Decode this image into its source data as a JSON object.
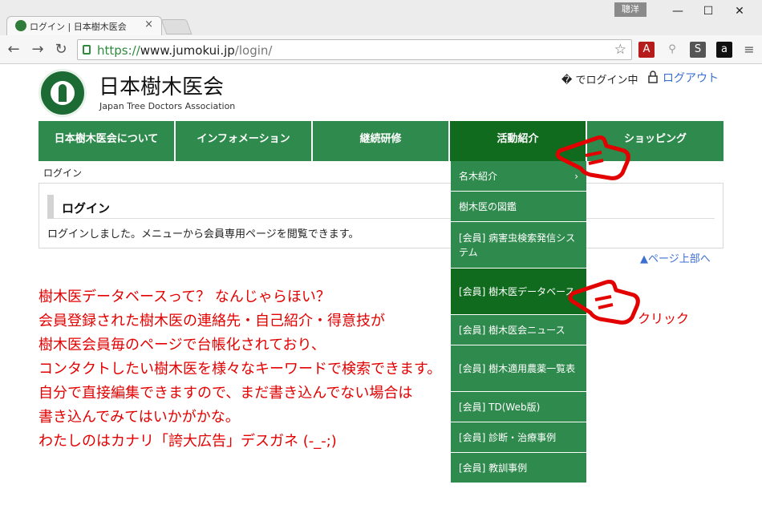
{
  "browser": {
    "tab_title": "ログイン | 日本樹木医会",
    "tab_close": "×",
    "lang_badge": "聰洋",
    "url_scheme": "https://",
    "url_host": "www.jumokui.jp",
    "url_path": "/login/"
  },
  "site": {
    "title": "日本樹木医会",
    "subtitle": "Japan Tree Doctors Association",
    "login_status": "� でログイン中",
    "logout": "ログアウト"
  },
  "nav": {
    "items": [
      {
        "label": "日本樹木医会について"
      },
      {
        "label": "インフォメーション"
      },
      {
        "label": "継続研修"
      },
      {
        "label": "活動紹介"
      },
      {
        "label": "ショッピング"
      }
    ]
  },
  "breadcrumb": "ログイン",
  "login": {
    "title": "ログイン",
    "message": "ログインしました。メニューから会員専用ページを閲覧できます。"
  },
  "page_top": "▲ページ上部へ",
  "dropdown": {
    "items": [
      {
        "label": "名木紹介"
      },
      {
        "label": "樹木医の図鑑"
      },
      {
        "label": "[会員] 病害虫検索発信システム"
      },
      {
        "label": "[会員] 樹木医データベース"
      },
      {
        "label": "[会員] 樹木医会ニュース"
      },
      {
        "label": "[会員] 樹木適用農薬一覧表"
      },
      {
        "label": "[会員] TD(Web版)"
      },
      {
        "label": "[会員] 診断・治療事例"
      },
      {
        "label": "[会員] 教訓事例"
      }
    ],
    "submenu_indicator": "›"
  },
  "annotation": {
    "lines": [
      "樹木医データベースって？ なんじゃらほい？",
      "会員登録された樹木医の連絡先・自己紹介・得意技が",
      "樹木医会員毎のページで台帳化されており、",
      "コンタクトしたい樹木医を様々なキーワードで検索できます。",
      "自分で直接編集できますので、まだ書き込んでない場合は",
      "書き込んでみてはいかがかな。",
      "わたしのはカナリ「誇大広告」デスガネ (-_-;)"
    ],
    "click_label": "クリック"
  },
  "colors": {
    "nav_green": "#2f8a4d",
    "nav_active": "#116b1f",
    "link_blue": "#3b6fd1",
    "annotation_red": "#e30000"
  }
}
